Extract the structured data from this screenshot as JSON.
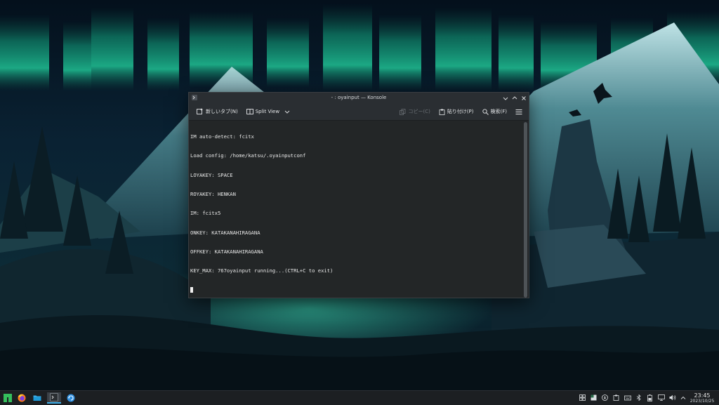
{
  "window": {
    "title": "- : oyainput — Konsole"
  },
  "toolbar": {
    "new_tab_label": "新しいタブ(N)",
    "split_view_label": "Split View",
    "copy_label": "コピー(C)",
    "paste_label": "貼り付け(P)",
    "find_label": "検索(F)"
  },
  "terminal": {
    "lines": [
      "IM auto-detect: fcitx",
      "Load config: /home/katsu/.oyainputconf",
      "LOYAKEY: SPACE",
      "ROYAKEY: HENKAN",
      "IM: fcitx5",
      "ONKEY: KATAKANAHIRAGANA",
      "OFFKEY: KATAKANAHIRAGANA",
      "KEY_MAX: 767oyainput running...(CTRL+C to exit)"
    ]
  },
  "taskbar": {
    "apps": [
      "application-launcher-icon",
      "firefox-icon",
      "file-manager-icon",
      "konsole-icon",
      "update-manager-icon"
    ],
    "tray": [
      "window-list-icon",
      "clipboard-icon",
      "update-icon",
      "package-icon",
      "keyboard-icon",
      "bluetooth-icon",
      "battery-icon",
      "display-icon",
      "volume-icon",
      "tray-expand-icon"
    ],
    "clock_time": "23:45",
    "clock_date": "2023/10/25"
  },
  "colors": {
    "accent": "#3daee9",
    "terminal_bg": "#232627",
    "terminal_fg": "#e8e8e8",
    "aurora_green": "#1fd4a0"
  }
}
